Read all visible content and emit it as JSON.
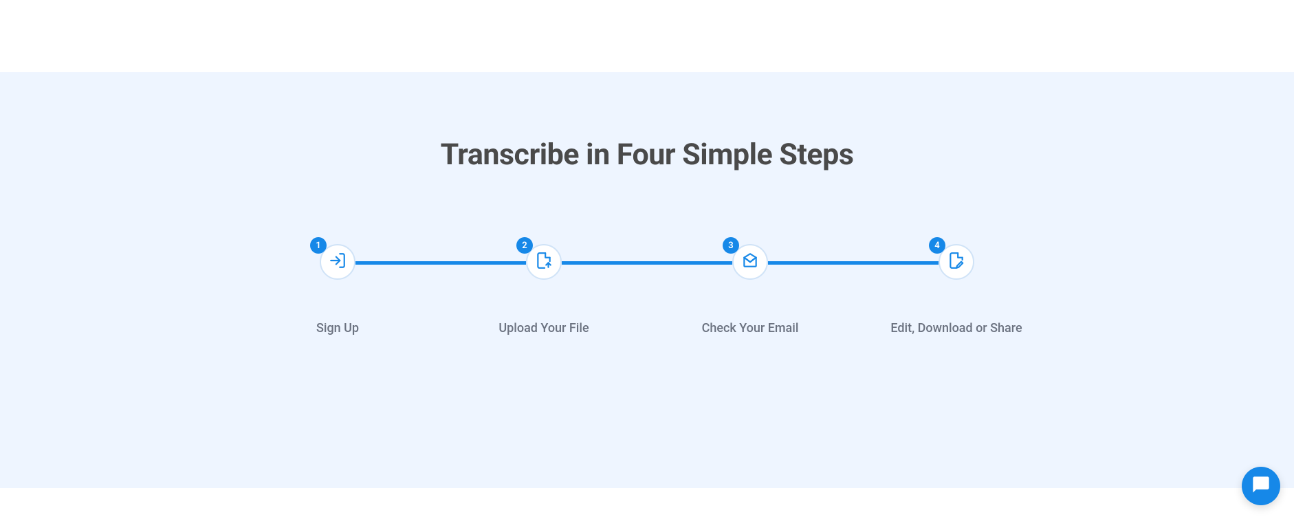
{
  "section": {
    "title": "Transcribe in Four Simple Steps"
  },
  "steps": [
    {
      "number": "1",
      "label": "Sign Up",
      "icon": "login-icon"
    },
    {
      "number": "2",
      "label": "Upload Your File",
      "icon": "file-upload-icon"
    },
    {
      "number": "3",
      "label": "Check Your Email",
      "icon": "email-icon"
    },
    {
      "number": "4",
      "label": "Edit, Download or Share",
      "icon": "file-edit-icon"
    }
  ],
  "colors": {
    "primary": "#1688e8",
    "background": "#eef5ff",
    "text_heading": "#4a4a4a",
    "text_muted": "#6b7280"
  }
}
